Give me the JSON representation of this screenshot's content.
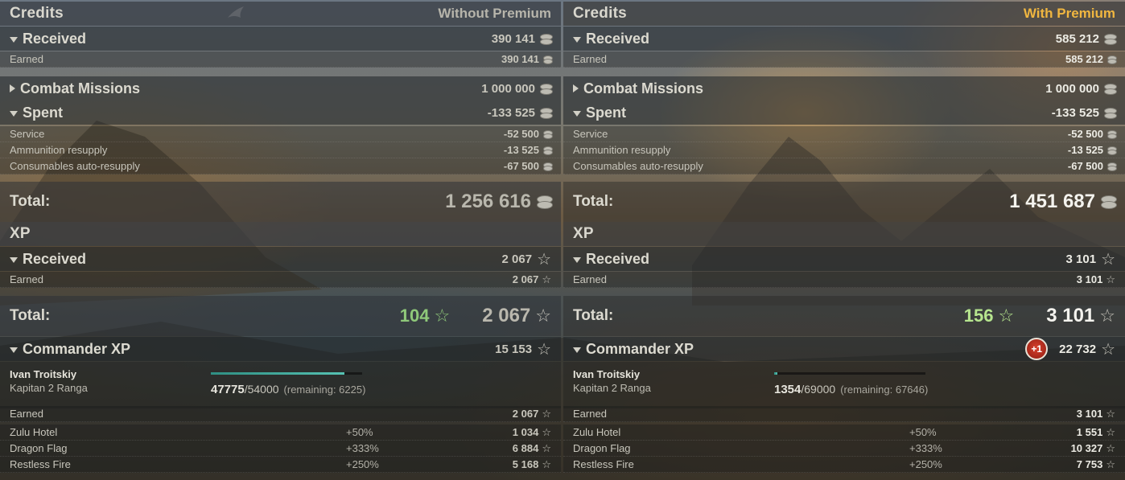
{
  "left": {
    "credits": {
      "title": "Credits",
      "premium_label": "Without Premium",
      "received": {
        "label": "Received",
        "value": "390 141"
      },
      "earned": {
        "label": "Earned",
        "value": "390 141"
      },
      "combat_missions": {
        "label": "Combat Missions",
        "value": "1 000 000"
      },
      "spent": {
        "label": "Spent",
        "value": "-133 525"
      },
      "service": {
        "label": "Service",
        "value": "-52 500"
      },
      "ammo": {
        "label": "Ammunition resupply",
        "value": "-13 525"
      },
      "consumables": {
        "label": "Consumables auto-resupply",
        "value": "-67 500"
      },
      "total": {
        "label": "Total:",
        "value": "1 256 616"
      }
    },
    "xp": {
      "title": "XP",
      "received": {
        "label": "Received",
        "value": "2 067"
      },
      "earned": {
        "label": "Earned",
        "value": "2 067"
      },
      "total": {
        "label": "Total:",
        "free_xp": "104",
        "value": "2 067"
      },
      "commander": {
        "label": "Commander XP",
        "value": "15 153",
        "name": "Ivan Troitskiy",
        "rank": "Kapitan 2 Ranga",
        "current": "47775",
        "max": "/54000",
        "remaining": "(remaining: 6225)",
        "progress": 0.885,
        "earned": {
          "label": "Earned",
          "value": "2 067"
        },
        "bonuses": [
          {
            "label": "Zulu Hotel",
            "pct": "+50%",
            "value": "1 034"
          },
          {
            "label": "Dragon Flag",
            "pct": "+333%",
            "value": "6 884"
          },
          {
            "label": "Restless Fire",
            "pct": "+250%",
            "value": "5 168"
          }
        ]
      }
    }
  },
  "right": {
    "credits": {
      "title": "Credits",
      "premium_label": "With Premium",
      "received": {
        "label": "Received",
        "value": "585 212"
      },
      "earned": {
        "label": "Earned",
        "value": "585 212"
      },
      "combat_missions": {
        "label": "Combat Missions",
        "value": "1 000 000"
      },
      "spent": {
        "label": "Spent",
        "value": "-133 525"
      },
      "service": {
        "label": "Service",
        "value": "-52 500"
      },
      "ammo": {
        "label": "Ammunition resupply",
        "value": "-13 525"
      },
      "consumables": {
        "label": "Consumables auto-resupply",
        "value": "-67 500"
      },
      "total": {
        "label": "Total:",
        "value": "1 451 687"
      }
    },
    "xp": {
      "title": "XP",
      "received": {
        "label": "Received",
        "value": "3 101"
      },
      "earned": {
        "label": "Earned",
        "value": "3 101"
      },
      "total": {
        "label": "Total:",
        "free_xp": "156",
        "value": "3 101"
      },
      "commander": {
        "label": "Commander XP",
        "badge": "+1",
        "value": "22 732",
        "name": "Ivan Troitskiy",
        "rank": "Kapitan 2 Ranga",
        "current": "1354",
        "max": "/69000",
        "remaining": "(remaining: 67646)",
        "progress": 0.02,
        "earned": {
          "label": "Earned",
          "value": "3 101"
        },
        "bonuses": [
          {
            "label": "Zulu Hotel",
            "pct": "+50%",
            "value": "1 551"
          },
          {
            "label": "Dragon Flag",
            "pct": "+333%",
            "value": "10 327"
          },
          {
            "label": "Restless Fire",
            "pct": "+250%",
            "value": "7 753"
          }
        ]
      }
    }
  },
  "icons": {
    "credits": "credits-coin-icon",
    "xp": "xp-star-icon",
    "star_glyph": "☆"
  },
  "colors": {
    "premium_gold": "#f0b640",
    "free_xp_green": "#8fc87a",
    "progress_teal": "#56c2b3",
    "badge_red": "#d9412c"
  }
}
